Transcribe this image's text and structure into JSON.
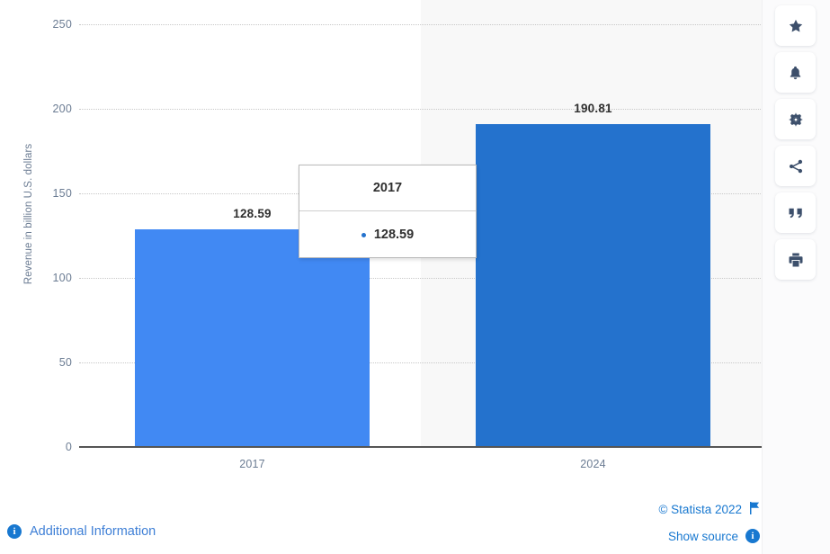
{
  "chart_data": {
    "type": "bar",
    "title": "",
    "xlabel": "",
    "ylabel": "Revenue in billion U.S. dollars",
    "categories": [
      "2017",
      "2024"
    ],
    "values": [
      128.59,
      190.81
    ],
    "value_labels": [
      "128.59",
      "190.81"
    ],
    "ylim": [
      0,
      250
    ],
    "yticks": [
      0,
      50,
      100,
      150,
      200,
      250
    ],
    "ytick_labels": [
      "0",
      "50",
      "100",
      "150",
      "200",
      "250"
    ],
    "grid": true,
    "legend": "none",
    "series_colors": [
      "#4189f3",
      "#2472cd"
    ],
    "highlighted_index": 1
  },
  "tooltip": {
    "header": "2017",
    "value": "128.59",
    "marker_color": "#2472cd"
  },
  "rail": {
    "items": [
      {
        "icon": "star-icon",
        "label": "Add to favorites"
      },
      {
        "icon": "bell-icon",
        "label": "Create alert"
      },
      {
        "icon": "gear-icon",
        "label": "Settings"
      },
      {
        "icon": "share-icon",
        "label": "Share"
      },
      {
        "icon": "quote-icon",
        "label": "Cite"
      },
      {
        "icon": "print-icon",
        "label": "Print"
      }
    ]
  },
  "footer": {
    "additional_information": "Additional Information",
    "copyright": "© Statista 2022",
    "show_source": "Show source",
    "info_glyph": "i"
  },
  "colors": {
    "bar_primary": "#4189f3",
    "bar_highlight": "#2472cd",
    "link": "#1878d0",
    "axis_text": "#6b7c93",
    "plot_band": "#f8f8f8"
  }
}
